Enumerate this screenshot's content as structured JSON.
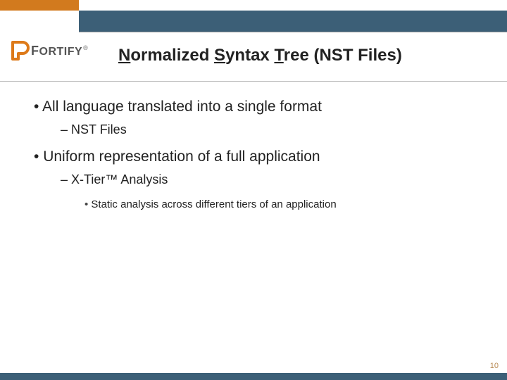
{
  "brand": {
    "name_first_letter": "F",
    "name_rest": "ORTIFY",
    "registered": "®"
  },
  "title": {
    "u1": "N",
    "t1": "ormalized ",
    "u2": "S",
    "t2": "yntax ",
    "u3": "T",
    "t3": "ree (NST Files)"
  },
  "bullets": {
    "b1a": "All language translated into a single format",
    "b2a": "NST Files",
    "b1b": "Uniform representation of a full application",
    "b2b": "X-Tier™ Analysis",
    "b3a": "Static analysis across different tiers of an application"
  },
  "page_number": "10",
  "colors": {
    "orange": "#d27a1e",
    "blue": "#3c5f77"
  }
}
